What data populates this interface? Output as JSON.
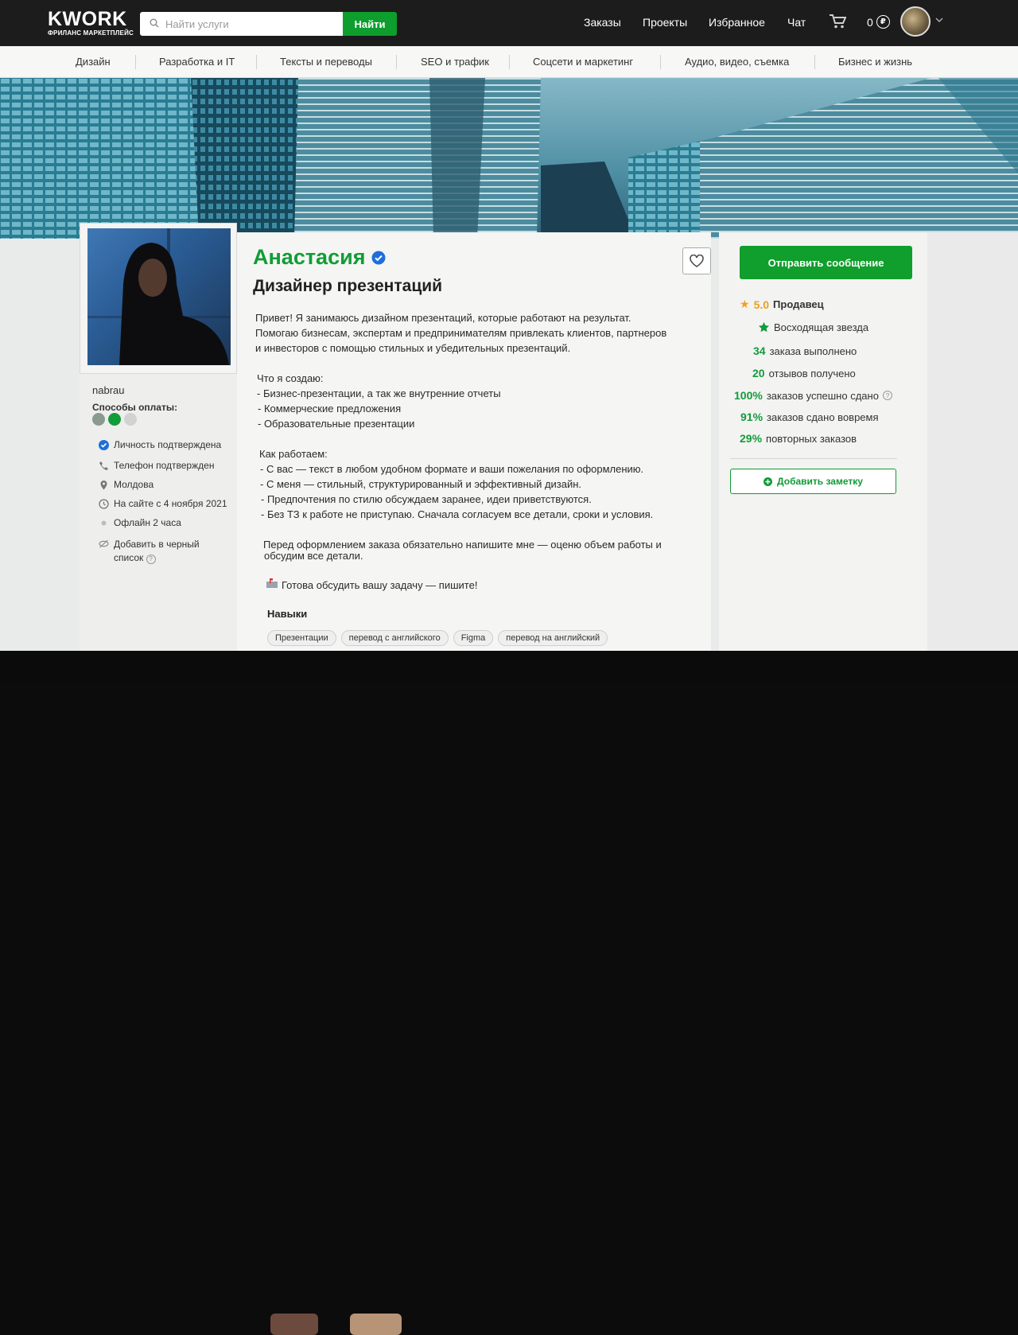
{
  "header": {
    "logo_main": "KWORK",
    "logo_sub": "ФРИЛАНС МАРКЕТПЛЕЙС",
    "search_placeholder": "Найти услуги",
    "search_button": "Найти",
    "nav": [
      "Заказы",
      "Проекты",
      "Избранное",
      "Чат"
    ],
    "balance": "0",
    "currency_symbol": "₽"
  },
  "categories": [
    "Дизайн",
    "Разработка и IT",
    "Тексты и переводы",
    "SEO и трафик",
    "Соцсети и маркетинг",
    "Аудио, видео, съемка",
    "Бизнес и жизнь"
  ],
  "profile": {
    "username": "nabrau",
    "payment_label": "Способы оплаты:",
    "info": {
      "identity": "Личность подтверждена",
      "phone": "Телефон подтвержден",
      "location": "Молдова",
      "since": "На сайте с 4 ноября 2021",
      "online": "Офлайн 2 часа",
      "blacklist_1": "Добавить в черный",
      "blacklist_2": "список"
    },
    "name": "Анастасия",
    "profession": "Дизайнер презентаций",
    "about": {
      "p1": "Привет! Я занимаюсь дизайном презентаций, которые работают на результат.",
      "p2": "Помогаю бизнесам, экспертам и предпринимателям привлекать клиентов, партнеров",
      "p3": "и инвесторов с помощью стильных и убедительных презентаций.",
      "p4": "Что я создаю:",
      "p5": "- Бизнес-презентации, а так же внутренние отчеты",
      "p6": "- Коммерческие предложения",
      "p7": "- Образовательные презентации",
      "p8": "Как работаем:",
      "p9": "- С вас — текст в любом удобном формате и ваши пожелания по оформлению.",
      "p10": "- С меня — стильный, структурированный и эффективный дизайн.",
      "p11": "- Предпочтения по стилю обсуждаем заранее, идеи приветствуются.",
      "p12": "- Без ТЗ к работе не приступаю. Сначала согласуем все детали, сроки и условия.",
      "p13": "Перед оформлением заказа обязательно напишите мне — оценю объем работы и",
      "p14": "обсудим все детали.",
      "p15": "Готова обсудить вашу задачу — пишите!"
    },
    "skills_title": "Навыки",
    "skills": [
      "Презентации",
      "перевод с английского",
      "Figma",
      "перевод на английский"
    ]
  },
  "sidebar_right": {
    "message_button": "Отправить сообщение",
    "rating": "5.0",
    "role": "Продавец",
    "badge": "Восходящая звезда",
    "stats": [
      {
        "num": "34",
        "label": "заказа выполнено"
      },
      {
        "num": "20",
        "label": "отзывов получено"
      },
      {
        "num": "100%",
        "label": "заказов успешно сдано"
      },
      {
        "num": "91%",
        "label": "заказов сдано вовремя"
      },
      {
        "num": "29%",
        "label": "повторных заказов"
      }
    ],
    "note_button": "Добавить заметку"
  },
  "colors": {
    "brand_green": "#119d36",
    "header_bg": "#1c1c1c",
    "star": "#f0a020"
  }
}
